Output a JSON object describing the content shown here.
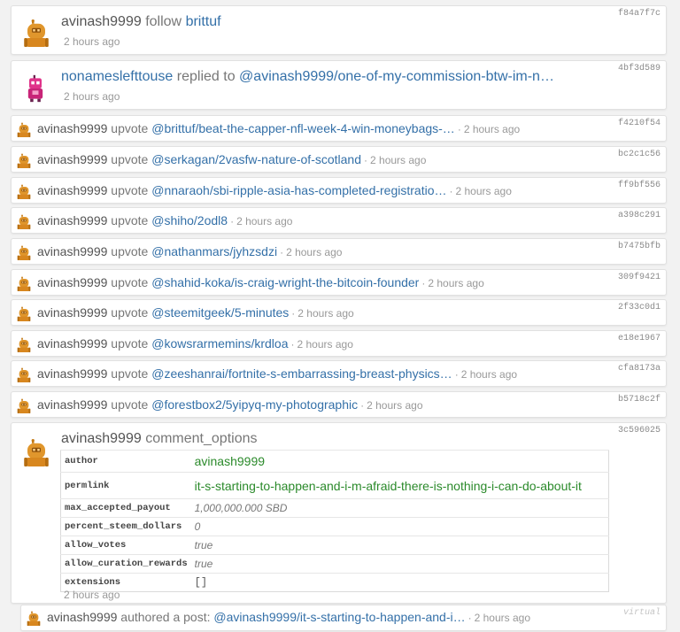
{
  "feed": {
    "follow": {
      "user": "avinash9999",
      "action": "follow",
      "target": "brittuf",
      "time": "2 hours ago",
      "hash": "f84a7f7c"
    },
    "reply": {
      "user": "nonameslefttouse",
      "action": "replied to",
      "target": "@avinash9999/one-of-my-commission-btw-im-n…",
      "time": "2 hours ago",
      "hash": "4bf3d589"
    },
    "upvotes": [
      {
        "user": "avinash9999",
        "action": "upvote",
        "target": "@brittuf/beat-the-capper-nfl-week-4-win-moneybags-…",
        "time": "2 hours ago",
        "hash": "f4210f54"
      },
      {
        "user": "avinash9999",
        "action": "upvote",
        "target": "@serkagan/2vasfw-nature-of-scotland",
        "time": "2 hours ago",
        "hash": "bc2c1c56"
      },
      {
        "user": "avinash9999",
        "action": "upvote",
        "target": "@nnaraoh/sbi-ripple-asia-has-completed-registratio…",
        "time": "2 hours ago",
        "hash": "ff9bf556"
      },
      {
        "user": "avinash9999",
        "action": "upvote",
        "target": "@shiho/2odl8",
        "time": "2 hours ago",
        "hash": "a398c291"
      },
      {
        "user": "avinash9999",
        "action": "upvote",
        "target": "@nathanmars/jyhzsdzi",
        "time": "2 hours ago",
        "hash": "b7475bfb"
      },
      {
        "user": "avinash9999",
        "action": "upvote",
        "target": "@shahid-koka/is-craig-wright-the-bitcoin-founder",
        "time": "2 hours ago",
        "hash": "309f9421"
      },
      {
        "user": "avinash9999",
        "action": "upvote",
        "target": "@steemitgeek/5-minutes",
        "time": "2 hours ago",
        "hash": "2f33c0d1"
      },
      {
        "user": "avinash9999",
        "action": "upvote",
        "target": "@kowsrarmemins/krdloa",
        "time": "2 hours ago",
        "hash": "e18e1967"
      },
      {
        "user": "avinash9999",
        "action": "upvote",
        "target": "@zeeshanrai/fortnite-s-embarrassing-breast-physics…",
        "time": "2 hours ago",
        "hash": "cfa8173a"
      },
      {
        "user": "avinash9999",
        "action": "upvote",
        "target": "@forestbox2/5yipyq-my-photographic",
        "time": "2 hours ago",
        "hash": "b5718c2f"
      }
    ],
    "comment_options": {
      "user": "avinash9999",
      "action": "comment_options",
      "time": "2 hours ago",
      "hash": "3c596025",
      "rows": [
        {
          "key": "author",
          "value": "avinash9999"
        },
        {
          "key": "permlink",
          "value": "it-s-starting-to-happen-and-i-m-afraid-there-is-nothing-i-can-do-about-it"
        },
        {
          "key": "max_accepted_payout",
          "value": "1,000,000.000 SBD"
        },
        {
          "key": "percent_steem_dollars",
          "value": "0"
        },
        {
          "key": "allow_votes",
          "value": "true"
        },
        {
          "key": "allow_curation_rewards",
          "value": "true"
        },
        {
          "key": "extensions",
          "value": "[]"
        }
      ]
    },
    "authored": {
      "user": "avinash9999",
      "action": "authored a post:",
      "target": "@avinash9999/it-s-starting-to-happen-and-i…",
      "time": "2 hours ago",
      "hash": "virtual"
    }
  },
  "colors": {
    "link": "#3470a8",
    "value_green": "#2b8a2b",
    "avatar_orange": "#e0962c",
    "avatar_pink": "#e0338a",
    "background": "#f2f2f2"
  },
  "icons": {
    "avatar_user": "robot-avatar-orange",
    "avatar_reply": "robot-avatar-pink"
  }
}
